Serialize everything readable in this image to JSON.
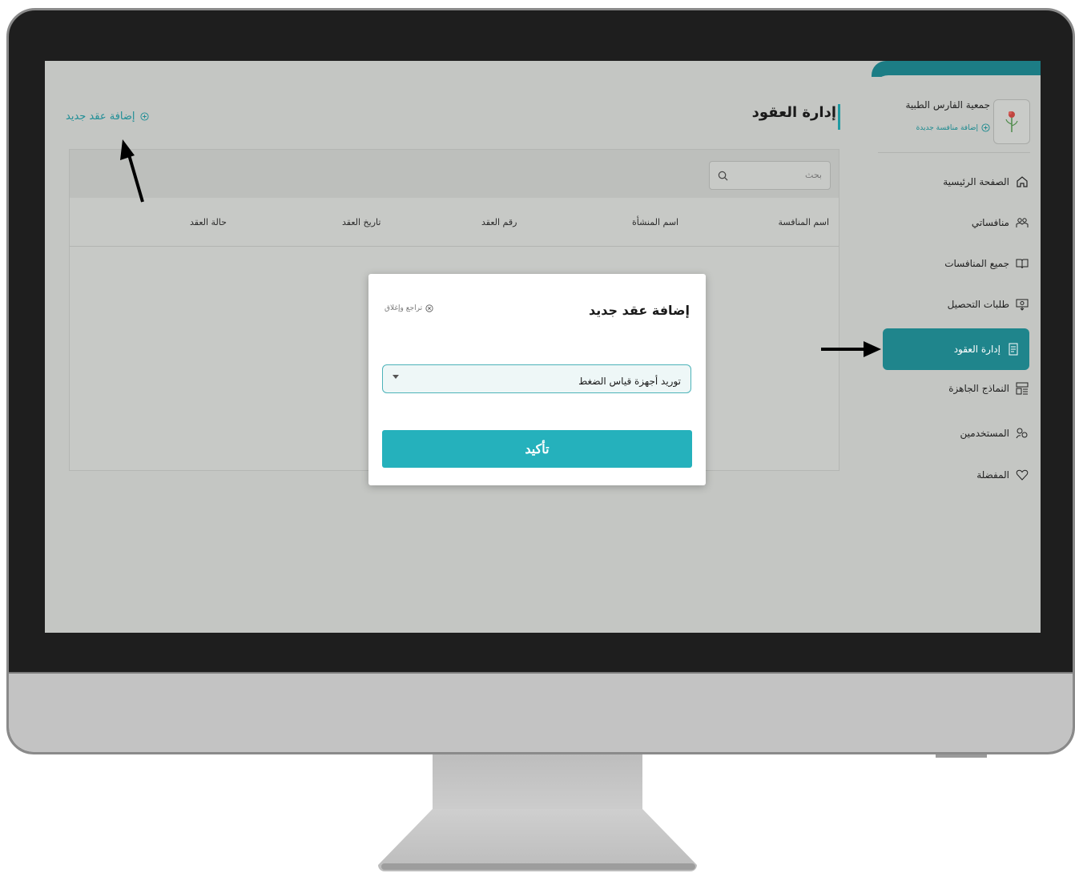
{
  "sidebar": {
    "org_name": "جمعية الفارس الطبية",
    "org_add_label": "إضافة منافسة جديدة",
    "items": [
      {
        "label": "الصفحة الرئيسية",
        "icon": "home-icon"
      },
      {
        "label": "منافساتي",
        "icon": "people-icon"
      },
      {
        "label": "جميع المنافسات",
        "icon": "book-icon"
      },
      {
        "label": "طلبات التحصيل",
        "icon": "money-icon"
      },
      {
        "label": "إدارة العقود",
        "icon": "contract-icon",
        "active": true
      },
      {
        "label": "النماذج الجاهزة",
        "icon": "template-icon"
      },
      {
        "label": "المستخدمين",
        "icon": "users-icon"
      },
      {
        "label": "المفضلة",
        "icon": "heart-icon"
      }
    ]
  },
  "main": {
    "page_title": "إدارة العقود",
    "add_contract_label": "إضافة عقد جديد",
    "search_placeholder": "بحث",
    "columns": [
      "اسم المنافسة",
      "اسم المنشأة",
      "رقم العقد",
      "تاريخ العقد",
      "حالة العقد"
    ]
  },
  "modal": {
    "title": "إضافة عقد جديد",
    "close_label": "تراجع وإغلاق",
    "selected_value": "توريد أجهزة قياس الضغط",
    "confirm_label": "تأكيد"
  },
  "colors": {
    "accent": "#25b1bc",
    "sidebar_active": "#1f858c",
    "link": "#1f8e96"
  }
}
